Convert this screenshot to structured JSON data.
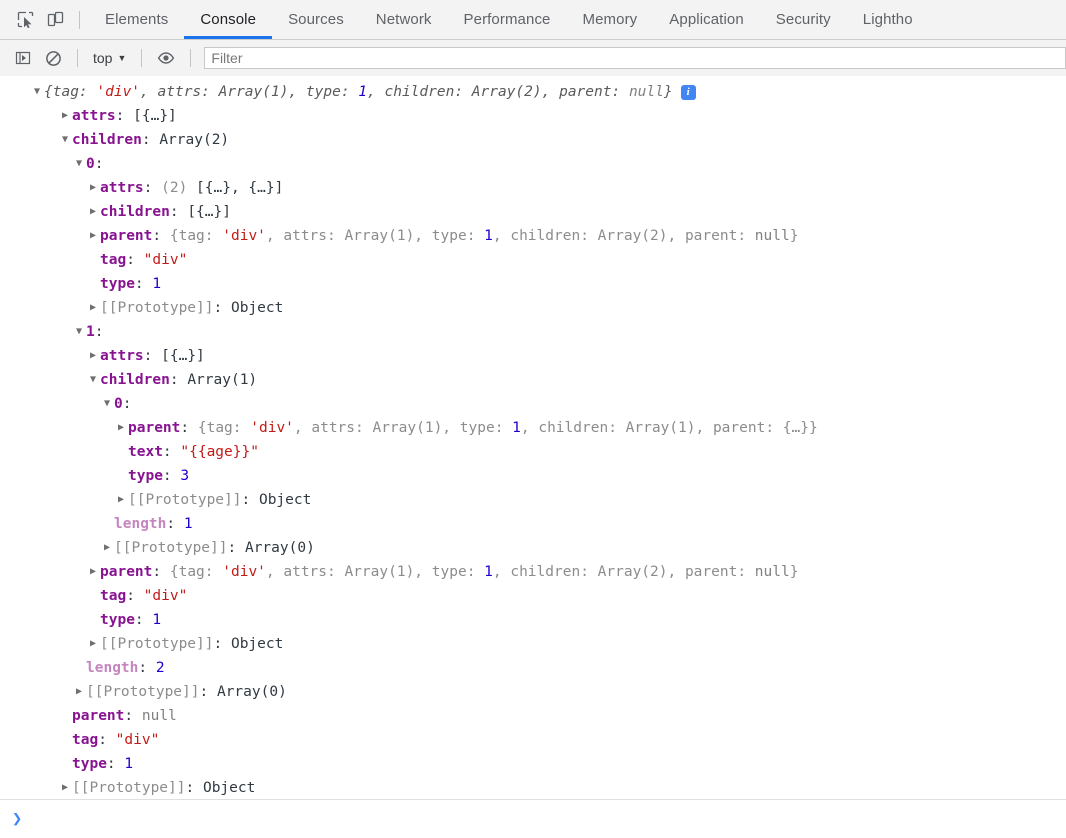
{
  "window": {
    "tool_icons": [
      {
        "name": "inspect-element-icon",
        "title": "Inspect element"
      },
      {
        "name": "device-toolbar-icon",
        "title": "Toggle device toolbar"
      }
    ],
    "tabs": [
      {
        "label": "Elements",
        "active": false
      },
      {
        "label": "Console",
        "active": true
      },
      {
        "label": "Sources",
        "active": false
      },
      {
        "label": "Network",
        "active": false
      },
      {
        "label": "Performance",
        "active": false
      },
      {
        "label": "Memory",
        "active": false
      },
      {
        "label": "Application",
        "active": false
      },
      {
        "label": "Security",
        "active": false
      },
      {
        "label": "Lightho",
        "active": false
      }
    ],
    "active_tab_color": "#1a73e8"
  },
  "console_toolbar": {
    "sidebar_toggle": "console-sidebar-icon",
    "clear_console": "clear-console-icon",
    "context": "top",
    "context_caret": "▼",
    "live_expression": "eye-icon",
    "filter_placeholder": "Filter"
  },
  "prompt": {
    "chevron": "›",
    "value": ""
  },
  "console_output": {
    "info_badge": "i",
    "lines": [
      {
        "id": "root-object",
        "indent": 0,
        "triangle": "▼",
        "expanded": true,
        "italic": true,
        "info": true,
        "tokens": [
          {
            "t": "{tag: ",
            "c": "plain"
          },
          {
            "t": "'div'",
            "c": "str"
          },
          {
            "t": ", attrs: Array(1), type: ",
            "c": "plain"
          },
          {
            "t": "1",
            "c": "num"
          },
          {
            "t": ", children: Array(2), parent: ",
            "c": "plain"
          },
          {
            "t": "null",
            "c": "null"
          },
          {
            "t": "}",
            "c": "plain"
          }
        ]
      },
      {
        "id": "root-attrs",
        "indent": 1,
        "triangle": "▶",
        "expanded": false,
        "tokens": [
          {
            "t": "attrs",
            "c": "prop"
          },
          {
            "t": ": ",
            "c": "plain"
          },
          {
            "t": "[{…}]",
            "c": "plain"
          }
        ]
      },
      {
        "id": "root-children",
        "indent": 1,
        "triangle": "▼",
        "expanded": true,
        "tokens": [
          {
            "t": "children",
            "c": "prop"
          },
          {
            "t": ": ",
            "c": "plain"
          },
          {
            "t": "Array(2)",
            "c": "plain"
          }
        ]
      },
      {
        "id": "child-0",
        "indent": 2,
        "triangle": "▼",
        "expanded": true,
        "tokens": [
          {
            "t": "0",
            "c": "idx"
          },
          {
            "t": ":",
            "c": "plain"
          }
        ]
      },
      {
        "id": "child-0-attrs",
        "indent": 3,
        "triangle": "▶",
        "expanded": false,
        "tokens": [
          {
            "t": "attrs",
            "c": "prop"
          },
          {
            "t": ": ",
            "c": "plain"
          },
          {
            "t": "(2)",
            "c": "grey"
          },
          {
            "t": " [{…}, {…}]",
            "c": "plain"
          }
        ]
      },
      {
        "id": "child-0-children",
        "indent": 3,
        "triangle": "▶",
        "expanded": false,
        "tokens": [
          {
            "t": "children",
            "c": "prop"
          },
          {
            "t": ": ",
            "c": "plain"
          },
          {
            "t": "[{…}]",
            "c": "plain"
          }
        ]
      },
      {
        "id": "child-0-parent",
        "indent": 3,
        "triangle": "▶",
        "expanded": false,
        "tokens": [
          {
            "t": "parent",
            "c": "prop"
          },
          {
            "t": ": ",
            "c": "plain"
          },
          {
            "t": "{tag: ",
            "c": "grey"
          },
          {
            "t": "'div'",
            "c": "str"
          },
          {
            "t": ", attrs: Array(1), type: ",
            "c": "grey"
          },
          {
            "t": "1",
            "c": "num"
          },
          {
            "t": ", children: Array(2), parent: ",
            "c": "grey"
          },
          {
            "t": "null",
            "c": "null"
          },
          {
            "t": "}",
            "c": "grey"
          }
        ]
      },
      {
        "id": "child-0-tag",
        "indent": 3,
        "triangle": "",
        "expanded": false,
        "tokens": [
          {
            "t": "tag",
            "c": "prop"
          },
          {
            "t": ": ",
            "c": "plain"
          },
          {
            "t": "\"div\"",
            "c": "str"
          }
        ]
      },
      {
        "id": "child-0-type",
        "indent": 3,
        "triangle": "",
        "expanded": false,
        "tokens": [
          {
            "t": "type",
            "c": "prop"
          },
          {
            "t": ": ",
            "c": "plain"
          },
          {
            "t": "1",
            "c": "num"
          }
        ]
      },
      {
        "id": "child-0-prototype",
        "indent": 3,
        "triangle": "▶",
        "expanded": false,
        "tokens": [
          {
            "t": "[[Prototype]]",
            "c": "proto"
          },
          {
            "t": ": ",
            "c": "plain"
          },
          {
            "t": "Object",
            "c": "plain"
          }
        ]
      },
      {
        "id": "child-1",
        "indent": 2,
        "triangle": "▼",
        "expanded": true,
        "tokens": [
          {
            "t": "1",
            "c": "idx"
          },
          {
            "t": ":",
            "c": "plain"
          }
        ]
      },
      {
        "id": "child-1-attrs",
        "indent": 3,
        "triangle": "▶",
        "expanded": false,
        "tokens": [
          {
            "t": "attrs",
            "c": "prop"
          },
          {
            "t": ": ",
            "c": "plain"
          },
          {
            "t": "[{…}]",
            "c": "plain"
          }
        ]
      },
      {
        "id": "child-1-children",
        "indent": 3,
        "triangle": "▼",
        "expanded": true,
        "tokens": [
          {
            "t": "children",
            "c": "prop"
          },
          {
            "t": ": ",
            "c": "plain"
          },
          {
            "t": "Array(1)",
            "c": "plain"
          }
        ]
      },
      {
        "id": "child-1-child-0",
        "indent": 4,
        "triangle": "▼",
        "expanded": true,
        "tokens": [
          {
            "t": "0",
            "c": "idx"
          },
          {
            "t": ":",
            "c": "plain"
          }
        ]
      },
      {
        "id": "text-node-parent",
        "indent": 5,
        "triangle": "▶",
        "expanded": false,
        "tokens": [
          {
            "t": "parent",
            "c": "prop"
          },
          {
            "t": ": ",
            "c": "plain"
          },
          {
            "t": "{tag: ",
            "c": "grey"
          },
          {
            "t": "'div'",
            "c": "str"
          },
          {
            "t": ", attrs: Array(1), type: ",
            "c": "grey"
          },
          {
            "t": "1",
            "c": "num"
          },
          {
            "t": ", children: Array(1), parent: {…}}",
            "c": "grey"
          }
        ]
      },
      {
        "id": "text-node-text",
        "indent": 5,
        "triangle": "",
        "expanded": false,
        "tokens": [
          {
            "t": "text",
            "c": "prop"
          },
          {
            "t": ": ",
            "c": "plain"
          },
          {
            "t": "\"{{age}}\"",
            "c": "str"
          }
        ]
      },
      {
        "id": "text-node-type",
        "indent": 5,
        "triangle": "",
        "expanded": false,
        "tokens": [
          {
            "t": "type",
            "c": "prop"
          },
          {
            "t": ": ",
            "c": "plain"
          },
          {
            "t": "3",
            "c": "num"
          }
        ]
      },
      {
        "id": "text-node-prototype",
        "indent": 5,
        "triangle": "▶",
        "expanded": false,
        "tokens": [
          {
            "t": "[[Prototype]]",
            "c": "proto"
          },
          {
            "t": ": ",
            "c": "plain"
          },
          {
            "t": "Object",
            "c": "plain"
          }
        ]
      },
      {
        "id": "child-1-children-length",
        "indent": 4,
        "triangle": "",
        "expanded": false,
        "tokens": [
          {
            "t": "length",
            "c": "len"
          },
          {
            "t": ": ",
            "c": "plain"
          },
          {
            "t": "1",
            "c": "num"
          }
        ]
      },
      {
        "id": "child-1-children-prototype",
        "indent": 4,
        "triangle": "▶",
        "expanded": false,
        "tokens": [
          {
            "t": "[[Prototype]]",
            "c": "proto"
          },
          {
            "t": ": ",
            "c": "plain"
          },
          {
            "t": "Array(0)",
            "c": "plain"
          }
        ]
      },
      {
        "id": "child-1-parent",
        "indent": 3,
        "triangle": "▶",
        "expanded": false,
        "tokens": [
          {
            "t": "parent",
            "c": "prop"
          },
          {
            "t": ": ",
            "c": "plain"
          },
          {
            "t": "{tag: ",
            "c": "grey"
          },
          {
            "t": "'div'",
            "c": "str"
          },
          {
            "t": ", attrs: Array(1), type: ",
            "c": "grey"
          },
          {
            "t": "1",
            "c": "num"
          },
          {
            "t": ", children: Array(2), parent: ",
            "c": "grey"
          },
          {
            "t": "null",
            "c": "null"
          },
          {
            "t": "}",
            "c": "grey"
          }
        ]
      },
      {
        "id": "child-1-tag",
        "indent": 3,
        "triangle": "",
        "expanded": false,
        "tokens": [
          {
            "t": "tag",
            "c": "prop"
          },
          {
            "t": ": ",
            "c": "plain"
          },
          {
            "t": "\"div\"",
            "c": "str"
          }
        ]
      },
      {
        "id": "child-1-type",
        "indent": 3,
        "triangle": "",
        "expanded": false,
        "tokens": [
          {
            "t": "type",
            "c": "prop"
          },
          {
            "t": ": ",
            "c": "plain"
          },
          {
            "t": "1",
            "c": "num"
          }
        ]
      },
      {
        "id": "child-1-prototype",
        "indent": 3,
        "triangle": "▶",
        "expanded": false,
        "tokens": [
          {
            "t": "[[Prototype]]",
            "c": "proto"
          },
          {
            "t": ": ",
            "c": "plain"
          },
          {
            "t": "Object",
            "c": "plain"
          }
        ]
      },
      {
        "id": "root-children-length",
        "indent": 2,
        "triangle": "",
        "expanded": false,
        "tokens": [
          {
            "t": "length",
            "c": "len"
          },
          {
            "t": ": ",
            "c": "plain"
          },
          {
            "t": "2",
            "c": "num"
          }
        ]
      },
      {
        "id": "root-children-prototype",
        "indent": 2,
        "triangle": "▶",
        "expanded": false,
        "tokens": [
          {
            "t": "[[Prototype]]",
            "c": "proto"
          },
          {
            "t": ": ",
            "c": "plain"
          },
          {
            "t": "Array(0)",
            "c": "plain"
          }
        ]
      },
      {
        "id": "root-parent",
        "indent": 1,
        "triangle": "",
        "expanded": false,
        "tokens": [
          {
            "t": "parent",
            "c": "prop"
          },
          {
            "t": ": ",
            "c": "plain"
          },
          {
            "t": "null",
            "c": "null"
          }
        ]
      },
      {
        "id": "root-tag",
        "indent": 1,
        "triangle": "",
        "expanded": false,
        "tokens": [
          {
            "t": "tag",
            "c": "prop"
          },
          {
            "t": ": ",
            "c": "plain"
          },
          {
            "t": "\"div\"",
            "c": "str"
          }
        ]
      },
      {
        "id": "root-type",
        "indent": 1,
        "triangle": "",
        "expanded": false,
        "tokens": [
          {
            "t": "type",
            "c": "prop"
          },
          {
            "t": ": ",
            "c": "plain"
          },
          {
            "t": "1",
            "c": "num"
          }
        ]
      },
      {
        "id": "root-prototype",
        "indent": 1,
        "triangle": "▶",
        "expanded": false,
        "tokens": [
          {
            "t": "[[Prototype]]",
            "c": "proto"
          },
          {
            "t": ": ",
            "c": "plain"
          },
          {
            "t": "Object",
            "c": "plain"
          }
        ]
      }
    ]
  }
}
